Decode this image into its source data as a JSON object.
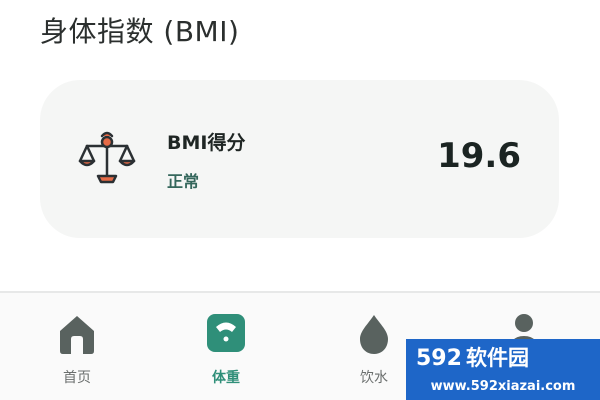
{
  "header": {
    "title": "身体指数 (BMI)"
  },
  "bmi_card": {
    "label": "BMI得分",
    "status": "正常",
    "score": "19.6",
    "icon": "balance-scale-icon",
    "icon_color": "#e66a46"
  },
  "bottom_nav": {
    "items": [
      {
        "label": "首页",
        "icon": "home-icon",
        "active": false
      },
      {
        "label": "体重",
        "icon": "weight-scale-icon",
        "active": true
      },
      {
        "label": "饮水",
        "icon": "water-drop-icon",
        "active": false
      },
      {
        "label": "",
        "icon": "profile-icon",
        "active": false
      }
    ],
    "active_color": "#2f8f79",
    "inactive_color": "#5d6665"
  },
  "watermark": {
    "logo_text": "592软件园",
    "url": "www.592xiazai.com",
    "background": "#1e66c8"
  }
}
